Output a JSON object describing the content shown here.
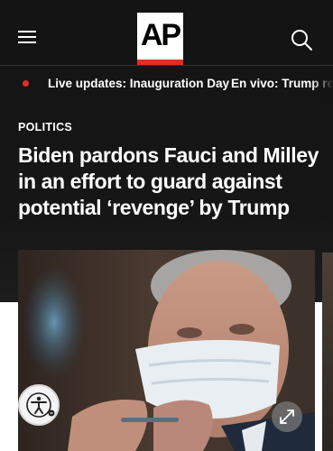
{
  "header": {
    "logo_text": "AP",
    "menu_icon": "hamburger-menu-icon",
    "search_icon": "search-icon",
    "brand_red": "#e42d26"
  },
  "ticker": {
    "items": [
      {
        "label": "Live updates: Inauguration Day"
      },
      {
        "label": "En vivo: Trump re"
      }
    ],
    "live_color": "#e42d26"
  },
  "article": {
    "section": "POLITICS",
    "headline": "Biden pardons Fauci and Milley in an effort to guard against potential ‘revenge’ by Trump"
  },
  "media": {
    "accessibility_icon": "accessibility-icon",
    "expand_icon": "expand-icon"
  }
}
